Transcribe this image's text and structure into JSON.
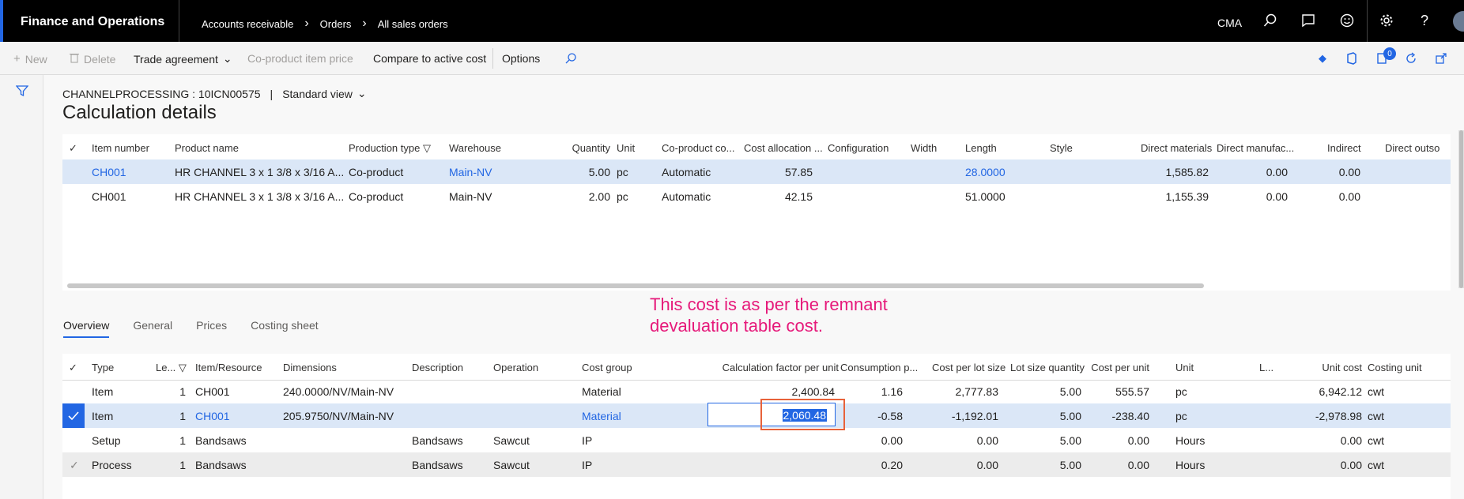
{
  "topbar": {
    "app_title": "Finance and Operations",
    "breadcrumbs": [
      "Accounts receivable",
      "Orders",
      "All sales orders"
    ],
    "company": "CMA"
  },
  "actions": {
    "new": "New",
    "delete": "Delete",
    "trade_agreement": "Trade agreement",
    "coproduct_item_price": "Co-product item price",
    "compare_active_cost": "Compare to active cost",
    "options": "Options",
    "notification_count": "0"
  },
  "page": {
    "record": "CHANNELPROCESSING : 10ICN00575",
    "view": "Standard view",
    "title": "Calculation details"
  },
  "top_grid": {
    "headers": [
      "Item number",
      "Product name",
      "Production type",
      "Warehouse",
      "Quantity",
      "Unit",
      "Co-product co...",
      "Cost allocation ...",
      "Configuration",
      "Width",
      "Length",
      "Style",
      "Direct materials",
      "Direct manufac...",
      "Indirect",
      "Direct outso"
    ],
    "rows": [
      {
        "item": "CH001",
        "product": "HR CHANNEL 3 x 1 3/8 x 3/16 A...",
        "type": "Co-product",
        "warehouse": "Main-NV",
        "qty": "5.00",
        "unit": "pc",
        "coproduct": "Automatic",
        "alloc": "57.85",
        "length": "28.0000",
        "direct_materials": "1,585.82",
        "direct_manuf": "0.00",
        "indirect": "0.00"
      },
      {
        "item": "CH001",
        "product": "HR CHANNEL 3 x 1 3/8 x 3/16 A...",
        "type": "Co-product",
        "warehouse": "Main-NV",
        "qty": "2.00",
        "unit": "pc",
        "coproduct": "Automatic",
        "alloc": "42.15",
        "length": "51.0000",
        "direct_materials": "1,155.39",
        "direct_manuf": "0.00",
        "indirect": "0.00"
      }
    ]
  },
  "annotation": "This cost is as per the remnant devaluation table cost.",
  "tabs": [
    "Overview",
    "General",
    "Prices",
    "Costing sheet"
  ],
  "bottom_grid": {
    "headers": [
      "Type",
      "Le...",
      "Item/Resource",
      "Dimensions",
      "Description",
      "Operation",
      "Cost group",
      "Calculation factor per unit",
      "Consumption p...",
      "Cost per lot size",
      "Lot size quantity",
      "Cost per unit",
      "Unit",
      "L...",
      "Unit cost",
      "Costing unit"
    ],
    "rows": [
      {
        "type": "Item",
        "level": "1",
        "resource": "CH001",
        "dimensions": "240.0000/NV/Main-NV",
        "description": "",
        "operation": "",
        "cost_group": "Material",
        "calc_factor": "2,400.84",
        "consumption": "1.16",
        "cost_lot": "2,777.83",
        "lot_qty": "5.00",
        "cost_unit": "555.57",
        "unit": "pc",
        "unit_cost": "6,942.12",
        "costing_unit": "cwt"
      },
      {
        "type": "Item",
        "level": "1",
        "resource": "CH001",
        "dimensions": "205.9750/NV/Main-NV",
        "description": "",
        "operation": "",
        "cost_group": "Material",
        "calc_factor": "2,060.48",
        "consumption": "-0.58",
        "cost_lot": "-1,192.01",
        "lot_qty": "5.00",
        "cost_unit": "-238.40",
        "unit": "pc",
        "unit_cost": "-2,978.98",
        "costing_unit": "cwt"
      },
      {
        "type": "Setup",
        "level": "1",
        "resource": "Bandsaws",
        "dimensions": "",
        "description": "Bandsaws",
        "operation": "Sawcut",
        "cost_group": "IP",
        "calc_factor": "",
        "consumption": "0.00",
        "cost_lot": "0.00",
        "lot_qty": "5.00",
        "cost_unit": "0.00",
        "unit": "Hours",
        "unit_cost": "0.00",
        "costing_unit": "cwt"
      },
      {
        "type": "Process",
        "level": "1",
        "resource": "Bandsaws",
        "dimensions": "",
        "description": "Bandsaws",
        "operation": "Sawcut",
        "cost_group": "IP",
        "calc_factor": "",
        "consumption": "0.20",
        "cost_lot": "0.00",
        "lot_qty": "5.00",
        "cost_unit": "0.00",
        "unit": "Hours",
        "unit_cost": "0.00",
        "costing_unit": "cwt"
      }
    ]
  }
}
